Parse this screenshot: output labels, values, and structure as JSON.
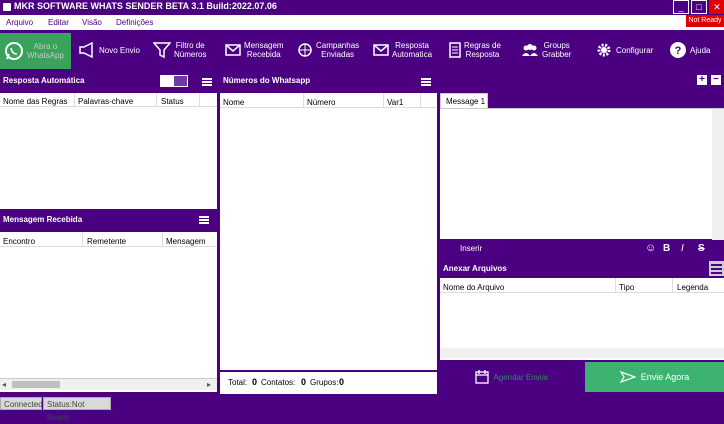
{
  "window": {
    "title": "MKR  SOFTWARE WHATS SENDER BETA 3.1 Build:2022.07.06",
    "status_flag": "Not Ready"
  },
  "menu": [
    "Arquivo",
    "Editar",
    "Visão",
    "Definições"
  ],
  "toolbar": {
    "whatsapp": "Abra o\nWhatsApp",
    "items": [
      "Novo Envio",
      "Filtro de\nNúmeros",
      "Mensagem\nRecebida",
      "Campanhas\nEnviadas",
      "Resposta\nAutomatica",
      "Regras de\nResposta",
      "Groups\nGrabber",
      "Configurar",
      "Ajuda"
    ]
  },
  "auto_reply": {
    "title": "Resposta  Automática",
    "columns": [
      "Nome das Regras",
      "Palavras-chave",
      "Status"
    ]
  },
  "received": {
    "title": "Mensagem Recebida",
    "columns": [
      "Encontro",
      "Remetente",
      "Mensagem"
    ]
  },
  "numbers": {
    "title": "Números do Whatsapp",
    "columns": [
      "Nome",
      "Número",
      "Var1"
    ]
  },
  "totals": {
    "total_label": "Total:",
    "total": "0",
    "contacts_label": "Contatos:",
    "contacts": "0",
    "groups_label": "Grupos:",
    "groups": "0"
  },
  "message": {
    "tab": "Message 1",
    "insert_label": "Inserir",
    "format_buttons": [
      "☺",
      "B",
      "I",
      "S"
    ]
  },
  "attach": {
    "title": "Anexar Arquivos",
    "columns": [
      "Nome do Arquivo",
      "Tipo",
      "Legenda"
    ]
  },
  "actions": {
    "schedule": "Agendar Enviar",
    "send_now": "Envie Agora"
  },
  "status_bar": {
    "connection": "Connected",
    "status": "Status:Not Ready"
  },
  "colors": {
    "brand": "#4b0082",
    "whatsapp": "#3aa35b",
    "send_now": "#3cb371",
    "alert": "#e00000"
  }
}
